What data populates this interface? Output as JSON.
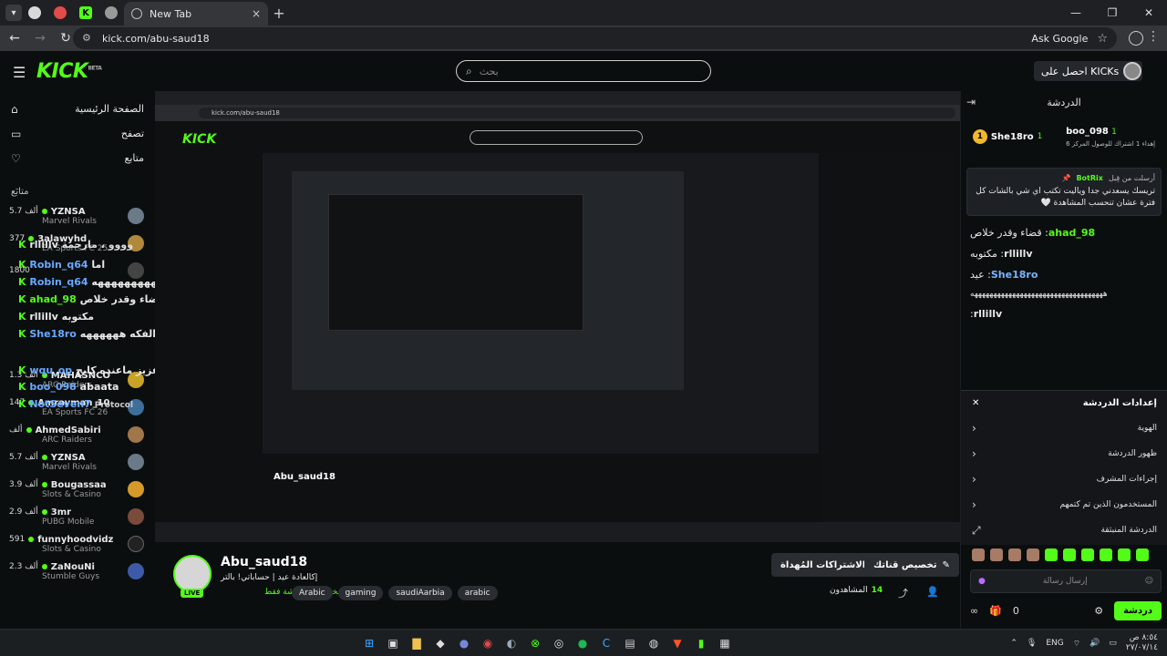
{
  "browser": {
    "tab_title": "New Tab",
    "url": "kick.com/abu-saud18",
    "ask_google": "Ask Google"
  },
  "header": {
    "logo": "KICK",
    "logo_badge": "BETA",
    "search_placeholder": "بحث",
    "get_kicks": "احصل على KICKs"
  },
  "sidebar": {
    "nav": [
      {
        "label": "الصفحة الرئيسية",
        "icon": "home-icon"
      },
      {
        "label": "تصفح",
        "icon": "browse-icon"
      },
      {
        "label": "متابع",
        "icon": "heart-icon"
      }
    ],
    "following_header": "متابَع",
    "channels": [
      {
        "viewers": "5.7 ألف",
        "name": "YZNSA",
        "category": "Marvel Rivals"
      },
      {
        "viewers": "377",
        "name": "3alawyhd",
        "category": "EA Sports FC 25"
      },
      {
        "viewers": "1800",
        "name": "",
        "category": ""
      },
      {
        "viewers": "1.3 ألف",
        "name": "MAHASNCO",
        "category": "ARC Raiders"
      },
      {
        "viewers": "147",
        "name": "Amrayman_10",
        "category": "EA Sports FC 26"
      },
      {
        "viewers": "ألف",
        "name": "AhmedSabiri",
        "category": "ARC Raiders"
      },
      {
        "viewers": "5.7 ألف",
        "name": "YZNSA",
        "category": "Marvel Rivals"
      },
      {
        "viewers": "3.9 ألف",
        "name": "Bougassaa",
        "category": "Slots & Casino"
      },
      {
        "viewers": "2.9 ألف",
        "name": "3mr",
        "category": "PUBG Mobile"
      },
      {
        "viewers": "591",
        "name": "funnyhoodvidz",
        "category": "Slots & Casino"
      },
      {
        "viewers": "2.3 ألف",
        "name": "ZaNouNi",
        "category": "Stumble Guys"
      }
    ]
  },
  "overlay_chat": [
    {
      "user": "rllillv",
      "text": "وووو ، مارحمة"
    },
    {
      "user": "Robin_q64",
      "text": "اما"
    },
    {
      "user": "Robin_q64",
      "text": "ههههههههههههههههههههههههههههههه"
    },
    {
      "user": "ahad_98",
      "text": "قضاء وقدر خلاص"
    },
    {
      "user": "rllillv",
      "text": "مكتوبه"
    },
    {
      "user": "She18ro",
      "text": "عيد تدور الفكه ههههههه"
    },
    {
      "user": "wqu_op",
      "text": "عزيز ماعنده كابح"
    },
    {
      "user": "boo_098",
      "text": "abaata"
    },
    {
      "user": "NotSeven7",
      "text": "Protocol"
    }
  ],
  "stream": {
    "streamer": "Abu_saud18",
    "title": "إكالعادة عيد | حساباتي! بالتر",
    "category": "مخصصة للدردشة فقط",
    "tags": [
      "Arabic",
      "gaming",
      "saudiAarbia",
      "arabic"
    ],
    "subscribe_label": "الاشتراكات المُهداة",
    "custom_label": "تخصيص قناتك",
    "viewers_label": "المشاهدون",
    "viewers_count": "14",
    "live": "LIVE"
  },
  "chat": {
    "header": "الدردشة",
    "gifters": [
      {
        "name": "She18ro",
        "count": "1",
        "rank": "1"
      },
      {
        "name": "boo_098",
        "count": "1",
        "sub": "إهداء 1 اشتراك للوصول المركز 6"
      }
    ],
    "pinned": {
      "bot": "BotRix",
      "sent_by": "أرسلت من قِبل",
      "text": "تريسك يسعدني جدا وياليت تكتب اي شي بالشات كل فترة عشان تنحسب المشاهدة 🤍"
    },
    "messages": [
      {
        "user": "ahad_98",
        "text": "قضاء وقدر خلاص",
        "color": "g"
      },
      {
        "user": "rllillv",
        "text": "مكتوبه",
        "color": ""
      },
      {
        "user": "She18ro",
        "text": "عيد",
        "color": "b"
      },
      {
        "user": "",
        "text": "هههههههههههههههههههههههههههههههههههه",
        "color": ""
      },
      {
        "user": "rllillv",
        "text": "",
        "color": ""
      },
      {
        "user": "wqu_op",
        "text": "",
        "color": "p"
      }
    ],
    "settings": {
      "title": "إعدادات الدردشة",
      "rows": [
        "الهوية",
        "ظهور الدردشة",
        "إجراءات المشرف",
        "المستخدمون الذين تم كتمهم",
        "الدردشة المنبثقة"
      ]
    },
    "input_placeholder": "إرسال رسالة",
    "points": "0",
    "chat_button": "دردشة"
  },
  "taskbar": {
    "lang": "ENG",
    "time": "٨:٥٤ ص",
    "date": "٢٧/٠٧/١٤"
  }
}
